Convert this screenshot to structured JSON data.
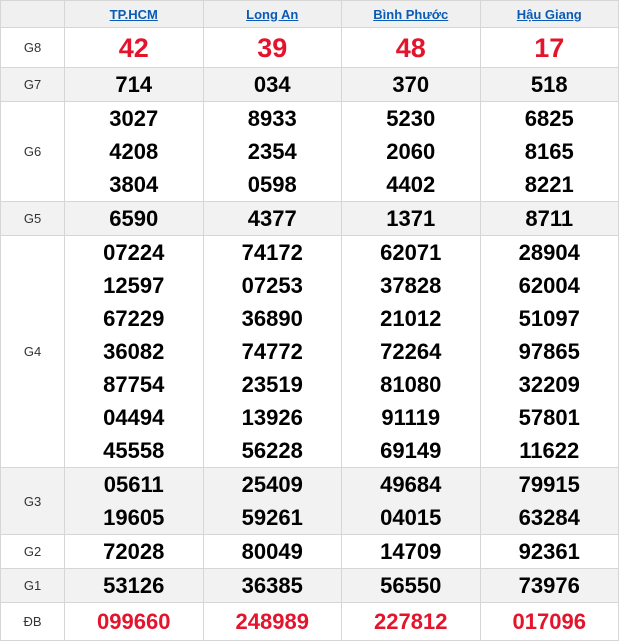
{
  "provinces": [
    "TP.HCM",
    "Long An",
    "Bình Phước",
    "Hậu Giang"
  ],
  "prizes": [
    {
      "label": "G8",
      "values": [
        [
          "42"
        ],
        [
          "39"
        ],
        [
          "48"
        ],
        [
          "17"
        ]
      ]
    },
    {
      "label": "G7",
      "values": [
        [
          "714"
        ],
        [
          "034"
        ],
        [
          "370"
        ],
        [
          "518"
        ]
      ]
    },
    {
      "label": "G6",
      "values": [
        [
          "3027",
          "4208",
          "3804"
        ],
        [
          "8933",
          "2354",
          "0598"
        ],
        [
          "5230",
          "2060",
          "4402"
        ],
        [
          "6825",
          "8165",
          "8221"
        ]
      ]
    },
    {
      "label": "G5",
      "values": [
        [
          "6590"
        ],
        [
          "4377"
        ],
        [
          "1371"
        ],
        [
          "8711"
        ]
      ]
    },
    {
      "label": "G4",
      "values": [
        [
          "07224",
          "12597",
          "67229",
          "36082",
          "87754",
          "04494",
          "45558"
        ],
        [
          "74172",
          "07253",
          "36890",
          "74772",
          "23519",
          "13926",
          "56228"
        ],
        [
          "62071",
          "37828",
          "21012",
          "72264",
          "81080",
          "91119",
          "69149"
        ],
        [
          "28904",
          "62004",
          "51097",
          "97865",
          "32209",
          "57801",
          "11622"
        ]
      ]
    },
    {
      "label": "G3",
      "values": [
        [
          "05611",
          "19605"
        ],
        [
          "25409",
          "59261"
        ],
        [
          "49684",
          "04015"
        ],
        [
          "79915",
          "63284"
        ]
      ]
    },
    {
      "label": "G2",
      "values": [
        [
          "72028"
        ],
        [
          "80049"
        ],
        [
          "14709"
        ],
        [
          "92361"
        ]
      ]
    },
    {
      "label": "G1",
      "values": [
        [
          "53126"
        ],
        [
          "36385"
        ],
        [
          "56550"
        ],
        [
          "73976"
        ]
      ]
    },
    {
      "label": "ĐB",
      "values": [
        [
          "099660"
        ],
        [
          "248989"
        ],
        [
          "227812"
        ],
        [
          "017096"
        ]
      ]
    }
  ],
  "colors": {
    "link": "#0a5bb5",
    "highlight": "#e3142b"
  }
}
